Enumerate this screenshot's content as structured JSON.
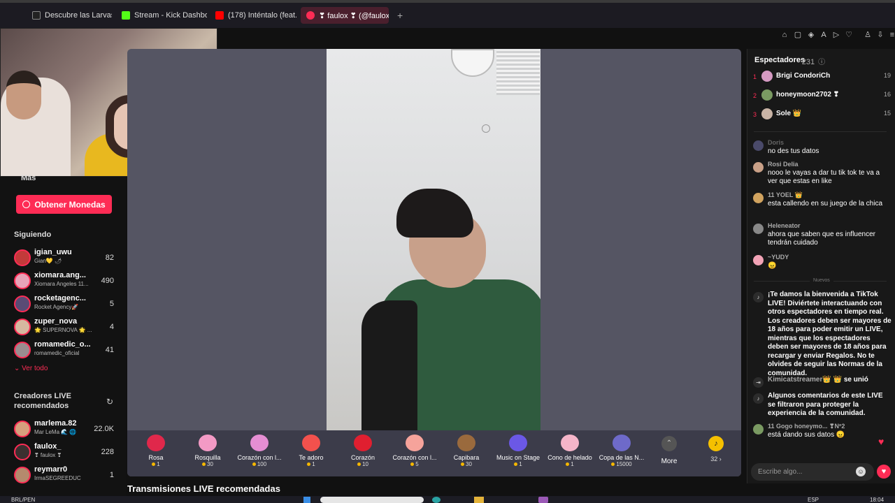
{
  "browser": {
    "tabs": [
      {
        "title": "Descubre las Larvas Ene",
        "active": false
      },
      {
        "title": "Stream - Kick Dashboard",
        "active": false
      },
      {
        "title": "(178) Inténtalo (feat. Amé",
        "active": false
      },
      {
        "title": "❣ faulox ❣ (@faulox",
        "active": true
      }
    ],
    "new_tab_label": "+"
  },
  "sidebar": {
    "more_label": "Más",
    "coins_button": "Obtener Monedas",
    "following_title": "Siguiendo",
    "following": [
      {
        "name": "igian_uwu",
        "sub": "Gian💛 🌶",
        "count": "82",
        "color": "#c23a3a"
      },
      {
        "name": "xiomara.ang...",
        "sub": "Xiomara Angeles 11...",
        "count": "490",
        "color": "#e7a3b8"
      },
      {
        "name": "rocketagenc...",
        "sub": "Rocket Agency🚀",
        "count": "5",
        "color": "#5a4b75"
      },
      {
        "name": "zuper_nova",
        "sub": "🌟 SUPERNOVA 🌟 ...",
        "count": "4",
        "color": "#d6b8a0"
      },
      {
        "name": "romamedic_o...",
        "sub": "romamedic_oficial",
        "count": "41",
        "color": "#9a8d90"
      }
    ],
    "see_all": "Ver todo",
    "recommended_title": "Creadores LIVE recomendados",
    "recommended": [
      {
        "name": "marlema.82",
        "sub": "Mar LeMa 🌊 🌐",
        "count": "22.0K",
        "color": "#d6a07e"
      },
      {
        "name": "faulox_",
        "sub": "❣ faulox ❣",
        "count": "228",
        "color": "#3b3030"
      },
      {
        "name": "reymarr0",
        "sub": "IrmaSEGREEDUC",
        "count": "1",
        "color": "#b58a6d"
      }
    ]
  },
  "gifts": [
    {
      "name": "Rosa",
      "price": "1",
      "color": "#e0284b"
    },
    {
      "name": "Rosquilla",
      "price": "30",
      "color": "#f39ac5"
    },
    {
      "name": "Corazón con l...",
      "price": "100",
      "color": "#e58ed3"
    },
    {
      "name": "Te adoro",
      "price": "1",
      "color": "#f2514d"
    },
    {
      "name": "Corazón",
      "price": "10",
      "color": "#e01f30"
    },
    {
      "name": "Corazón con l...",
      "price": "5",
      "color": "#f6a39b"
    },
    {
      "name": "Capibara",
      "price": "30",
      "color": "#9a6a3d"
    },
    {
      "name": "Music on Stage",
      "price": "1",
      "color": "#6b58e6"
    },
    {
      "name": "Cono de helado",
      "price": "1",
      "color": "#f5b5c9"
    },
    {
      "name": "Copa de las N...",
      "price": "15000",
      "color": "#6e6ac9"
    }
  ],
  "more_label": "More",
  "coin_count": "32 ›",
  "recommended_lives_title": "Transmisiones LIVE recomendadas",
  "chat": {
    "viewers_title": "Espectadores",
    "viewers_count": "· 231",
    "top_viewers": [
      {
        "rank": "1",
        "name": "Brigi CondoriCh",
        "score": "19",
        "color": "#d59ac2"
      },
      {
        "rank": "2",
        "name": "honeymoon2702 ❣",
        "score": "16",
        "color": "#7a9a62"
      },
      {
        "rank": "3",
        "name": "Sole 👑",
        "score": "15",
        "color": "#c9b4a6"
      }
    ],
    "messages": [
      {
        "author": "Doris",
        "text": "no des tus datos",
        "color": "#4a4a6a"
      },
      {
        "author": "Rosi Delia",
        "text": "nooo le vayas a dar tu tik tok te va a ver que estas en like",
        "color": "#c9a087"
      },
      {
        "author": "11 YOEL 👑",
        "text": "esta callendo en su juego de la chica",
        "color": "#d1a35f"
      },
      {
        "author": "Heleneator",
        "text": "ahora que saben que es influencer tendrán cuidado",
        "color": "#888"
      },
      {
        "author": "~YUDY",
        "text": "😠",
        "color": "#f2a3b6"
      }
    ],
    "new_label": "Nuevos",
    "system_welcome": "¡Te damos la bienvenida a TikTok LIVE! Diviértete interactuando con otros espectadores en tiempo real. Los creadores deben ser mayores de 18 años para poder emitir un LIVE, mientras que los espectadores deben ser mayores de 18 años para recargar y enviar Regalos. No te olvides de seguir las Normas de la comunidad.",
    "join_user": "Kimicatstreamer👑 👑",
    "join_text": "se unió",
    "system_filter": "Algunos comentarios de este LIVE se filtraron para proteger la experiencia de la comunidad.",
    "last_author": "11 Gogo honeymo... ❣Nº2",
    "last_text": "está dando sus datos 😠",
    "input_placeholder": "Escribe algo..."
  },
  "taskbar": {
    "currency": "BRL/PEN",
    "lang": "ESP",
    "time": "18:04"
  }
}
